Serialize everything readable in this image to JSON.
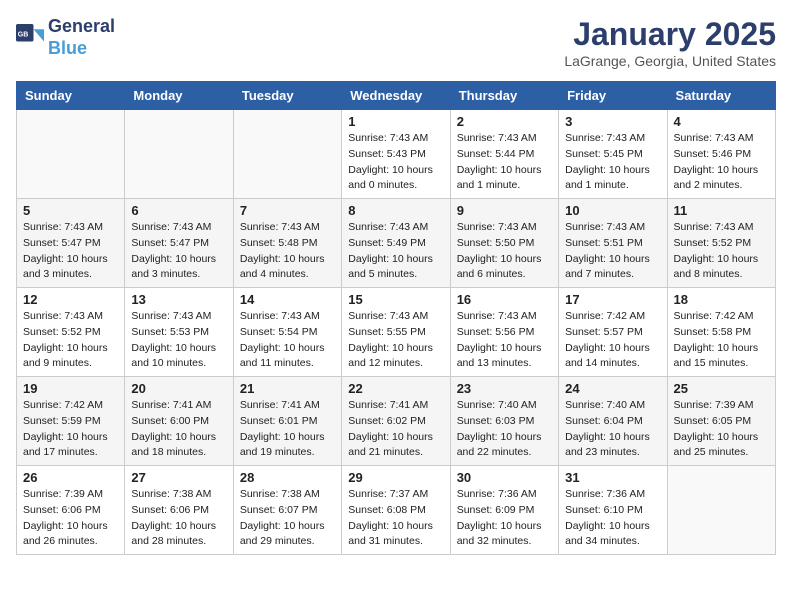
{
  "header": {
    "logo_line1": "General",
    "logo_line2": "Blue",
    "month": "January 2025",
    "location": "LaGrange, Georgia, United States"
  },
  "weekdays": [
    "Sunday",
    "Monday",
    "Tuesday",
    "Wednesday",
    "Thursday",
    "Friday",
    "Saturday"
  ],
  "weeks": [
    [
      {
        "day": "",
        "info": ""
      },
      {
        "day": "",
        "info": ""
      },
      {
        "day": "",
        "info": ""
      },
      {
        "day": "1",
        "info": "Sunrise: 7:43 AM\nSunset: 5:43 PM\nDaylight: 10 hours\nand 0 minutes."
      },
      {
        "day": "2",
        "info": "Sunrise: 7:43 AM\nSunset: 5:44 PM\nDaylight: 10 hours\nand 1 minute."
      },
      {
        "day": "3",
        "info": "Sunrise: 7:43 AM\nSunset: 5:45 PM\nDaylight: 10 hours\nand 1 minute."
      },
      {
        "day": "4",
        "info": "Sunrise: 7:43 AM\nSunset: 5:46 PM\nDaylight: 10 hours\nand 2 minutes."
      }
    ],
    [
      {
        "day": "5",
        "info": "Sunrise: 7:43 AM\nSunset: 5:47 PM\nDaylight: 10 hours\nand 3 minutes."
      },
      {
        "day": "6",
        "info": "Sunrise: 7:43 AM\nSunset: 5:47 PM\nDaylight: 10 hours\nand 3 minutes."
      },
      {
        "day": "7",
        "info": "Sunrise: 7:43 AM\nSunset: 5:48 PM\nDaylight: 10 hours\nand 4 minutes."
      },
      {
        "day": "8",
        "info": "Sunrise: 7:43 AM\nSunset: 5:49 PM\nDaylight: 10 hours\nand 5 minutes."
      },
      {
        "day": "9",
        "info": "Sunrise: 7:43 AM\nSunset: 5:50 PM\nDaylight: 10 hours\nand 6 minutes."
      },
      {
        "day": "10",
        "info": "Sunrise: 7:43 AM\nSunset: 5:51 PM\nDaylight: 10 hours\nand 7 minutes."
      },
      {
        "day": "11",
        "info": "Sunrise: 7:43 AM\nSunset: 5:52 PM\nDaylight: 10 hours\nand 8 minutes."
      }
    ],
    [
      {
        "day": "12",
        "info": "Sunrise: 7:43 AM\nSunset: 5:52 PM\nDaylight: 10 hours\nand 9 minutes."
      },
      {
        "day": "13",
        "info": "Sunrise: 7:43 AM\nSunset: 5:53 PM\nDaylight: 10 hours\nand 10 minutes."
      },
      {
        "day": "14",
        "info": "Sunrise: 7:43 AM\nSunset: 5:54 PM\nDaylight: 10 hours\nand 11 minutes."
      },
      {
        "day": "15",
        "info": "Sunrise: 7:43 AM\nSunset: 5:55 PM\nDaylight: 10 hours\nand 12 minutes."
      },
      {
        "day": "16",
        "info": "Sunrise: 7:43 AM\nSunset: 5:56 PM\nDaylight: 10 hours\nand 13 minutes."
      },
      {
        "day": "17",
        "info": "Sunrise: 7:42 AM\nSunset: 5:57 PM\nDaylight: 10 hours\nand 14 minutes."
      },
      {
        "day": "18",
        "info": "Sunrise: 7:42 AM\nSunset: 5:58 PM\nDaylight: 10 hours\nand 15 minutes."
      }
    ],
    [
      {
        "day": "19",
        "info": "Sunrise: 7:42 AM\nSunset: 5:59 PM\nDaylight: 10 hours\nand 17 minutes."
      },
      {
        "day": "20",
        "info": "Sunrise: 7:41 AM\nSunset: 6:00 PM\nDaylight: 10 hours\nand 18 minutes."
      },
      {
        "day": "21",
        "info": "Sunrise: 7:41 AM\nSunset: 6:01 PM\nDaylight: 10 hours\nand 19 minutes."
      },
      {
        "day": "22",
        "info": "Sunrise: 7:41 AM\nSunset: 6:02 PM\nDaylight: 10 hours\nand 21 minutes."
      },
      {
        "day": "23",
        "info": "Sunrise: 7:40 AM\nSunset: 6:03 PM\nDaylight: 10 hours\nand 22 minutes."
      },
      {
        "day": "24",
        "info": "Sunrise: 7:40 AM\nSunset: 6:04 PM\nDaylight: 10 hours\nand 23 minutes."
      },
      {
        "day": "25",
        "info": "Sunrise: 7:39 AM\nSunset: 6:05 PM\nDaylight: 10 hours\nand 25 minutes."
      }
    ],
    [
      {
        "day": "26",
        "info": "Sunrise: 7:39 AM\nSunset: 6:06 PM\nDaylight: 10 hours\nand 26 minutes."
      },
      {
        "day": "27",
        "info": "Sunrise: 7:38 AM\nSunset: 6:06 PM\nDaylight: 10 hours\nand 28 minutes."
      },
      {
        "day": "28",
        "info": "Sunrise: 7:38 AM\nSunset: 6:07 PM\nDaylight: 10 hours\nand 29 minutes."
      },
      {
        "day": "29",
        "info": "Sunrise: 7:37 AM\nSunset: 6:08 PM\nDaylight: 10 hours\nand 31 minutes."
      },
      {
        "day": "30",
        "info": "Sunrise: 7:36 AM\nSunset: 6:09 PM\nDaylight: 10 hours\nand 32 minutes."
      },
      {
        "day": "31",
        "info": "Sunrise: 7:36 AM\nSunset: 6:10 PM\nDaylight: 10 hours\nand 34 minutes."
      },
      {
        "day": "",
        "info": ""
      }
    ]
  ]
}
